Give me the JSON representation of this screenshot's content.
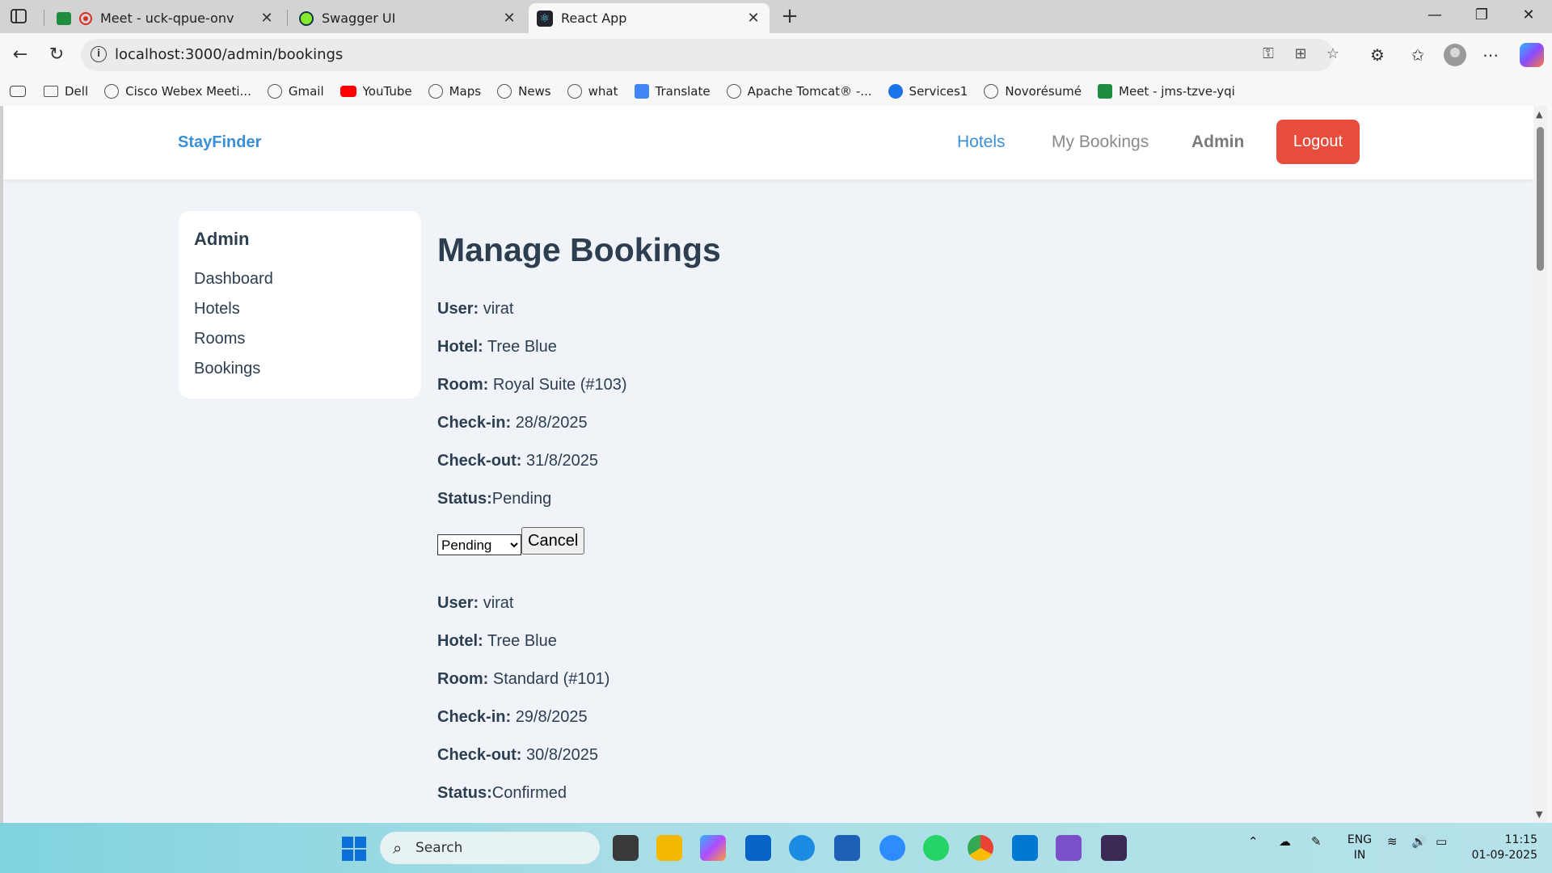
{
  "browser": {
    "tabs": [
      {
        "title": "Meet - uck-qpue-onv",
        "active": false
      },
      {
        "title": "Swagger UI",
        "active": false
      },
      {
        "title": "React App",
        "active": true
      }
    ],
    "url": "localhost:3000/admin/bookings",
    "bookmarks": [
      "Dell",
      "Cisco Webex Meeti...",
      "Gmail",
      "YouTube",
      "Maps",
      "News",
      "what",
      "Translate",
      "Apache Tomcat® -...",
      "Services1",
      "Novorésumé",
      "Meet - jms-tzve-yqi"
    ]
  },
  "app": {
    "brand": "StayFinder",
    "nav": {
      "hotels": "Hotels",
      "my_bookings": "My Bookings",
      "admin": "Admin",
      "logout": "Logout"
    },
    "colors": {
      "brand": "#3a8fd6",
      "logout": "#e74c3c",
      "text": "#2c3e50",
      "background": "#f0f4f8"
    }
  },
  "sidebar": {
    "title": "Admin",
    "items": [
      "Dashboard",
      "Hotels",
      "Rooms",
      "Bookings"
    ]
  },
  "page": {
    "title": "Manage Bookings",
    "labels": {
      "user": "User:",
      "hotel": "Hotel:",
      "room": "Room:",
      "checkin": "Check-in:",
      "checkout": "Check-out:",
      "status": "Status:"
    },
    "cancel_label": "Cancel",
    "bookings": [
      {
        "user": "virat",
        "hotel": "Tree Blue",
        "room": "Royal Suite (#103)",
        "checkin": "28/8/2025",
        "checkout": "31/8/2025",
        "status": "Pending",
        "select_value": "Pending"
      },
      {
        "user": "virat",
        "hotel": "Tree Blue",
        "room": "Standard (#101)",
        "checkin": "29/8/2025",
        "checkout": "30/8/2025",
        "status": "Confirmed"
      }
    ]
  },
  "taskbar": {
    "search_placeholder": "Search",
    "language": "ENG",
    "region": "IN",
    "time": "11:15",
    "date": "01-09-2025"
  }
}
